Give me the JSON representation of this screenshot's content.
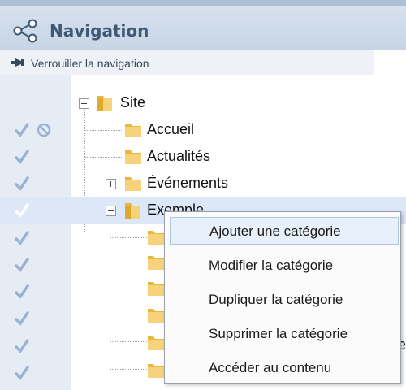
{
  "header": {
    "title": "Navigation",
    "icon": "share-network-icon"
  },
  "lock": {
    "label": "Verrouiller la navigation",
    "icon": "pin-icon"
  },
  "tree": {
    "root": "Site",
    "items": [
      {
        "label": "Accueil"
      },
      {
        "label": "Actualités"
      },
      {
        "label": "Événements"
      },
      {
        "label": "Exemple"
      }
    ]
  },
  "context_menu": {
    "items": [
      "Ajouter une catégorie",
      "Modifier la catégorie",
      "Dupliquer la catégorie",
      "Supprimer la catégorie",
      "Accéder au contenu"
    ]
  },
  "partial_text": {
    "clipped_right": "e"
  },
  "colors": {
    "header_bg": "#c7d5e6",
    "title": "#3e5876",
    "gutter": "#e6ecf4",
    "selected_row": "#dce8f8",
    "check": "#9bb3d3",
    "folder": "#f2c55c"
  }
}
